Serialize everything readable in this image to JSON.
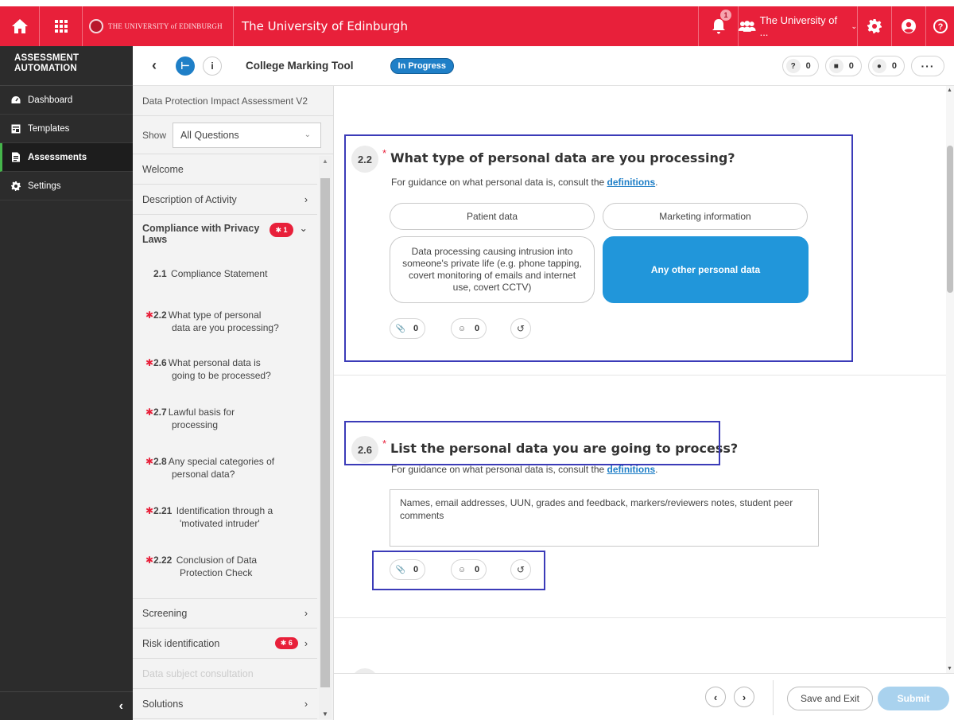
{
  "topbar": {
    "brand_text": "THE UNIVERSITY of EDINBURGH",
    "title": "The University of Edinburgh",
    "notification_count": "1",
    "org_label": "The University of ...",
    "color": "#e8203a"
  },
  "sidebar": {
    "header_line1": "ASSESSMENT",
    "header_line2": "AUTOMATION",
    "items": [
      {
        "label": "Dashboard",
        "icon": "dashboard-icon"
      },
      {
        "label": "Templates",
        "icon": "templates-icon"
      },
      {
        "label": "Assessments",
        "icon": "assessments-icon"
      },
      {
        "label": "Settings",
        "icon": "gear-icon"
      }
    ],
    "active": "Assessments"
  },
  "subheader": {
    "tool_title": "College Marking Tool",
    "status": "In Progress",
    "counters": [
      {
        "icon": "question-icon",
        "value": "0"
      },
      {
        "icon": "note-icon",
        "value": "0"
      },
      {
        "icon": "comment-icon",
        "value": "0"
      }
    ],
    "more_label": "···"
  },
  "qnav": {
    "title": "Data Protection Impact Assessment V2",
    "show_label": "Show",
    "show_value": "All Questions",
    "sections": {
      "welcome": "Welcome",
      "description": "Description of Activity",
      "compliance_line1": "Compliance with Privacy",
      "compliance_line2": "Laws",
      "compliance_badge": "✱ 1",
      "screening": "Screening",
      "risk": "Risk identification",
      "risk_badge": "✱ 6",
      "consultation": "Data subject consultation",
      "solutions": "Solutions"
    },
    "questions": [
      {
        "num": "2.1",
        "line1": "Compliance Statement",
        "line2": "",
        "required": false
      },
      {
        "num": "2.2",
        "line1": "What type of personal",
        "line2": "data are you processing?",
        "required": true
      },
      {
        "num": "2.6",
        "line1": "What personal data is",
        "line2": "going to be processed?",
        "required": true
      },
      {
        "num": "2.7",
        "line1": "Lawful basis for",
        "line2": "processing",
        "required": true
      },
      {
        "num": "2.8",
        "line1": "Any special categories of",
        "line2": "personal data?",
        "required": true
      },
      {
        "num": "2.21",
        "line1": "Identification through a",
        "line2": "'motivated intruder'",
        "required": true
      },
      {
        "num": "2.22",
        "line1": "Conclusion of Data",
        "line2": "Protection Check",
        "required": true
      }
    ]
  },
  "main": {
    "q22": {
      "num": "2.2",
      "title": "What type of personal data are you processing?",
      "guide_prefix": "For guidance on what personal data is, consult the ",
      "guide_link": "definitions",
      "guide_suffix": ".",
      "options": [
        "Patient data",
        "Marketing information",
        "Data processing causing intrusion into someone's private life (e.g. phone tapping, covert monitoring of emails and internet use, covert CCTV)",
        "Any other personal data"
      ],
      "selected": "Any other personal data",
      "attachments": "0",
      "comments": "0"
    },
    "q26": {
      "num": "2.6",
      "title": "List the personal data you are going to process?",
      "guide_prefix": "For guidance on what personal data is, consult the ",
      "guide_link": "definitions",
      "guide_suffix": ".",
      "answer": "Names, email addresses, UUN, grades and feedback, markers/reviewers notes, student peer comments",
      "attachments": "0",
      "comments": "0"
    },
    "selected_color": "#2196da"
  },
  "footer": {
    "save_label": "Save and Exit",
    "submit_label": "Submit"
  }
}
